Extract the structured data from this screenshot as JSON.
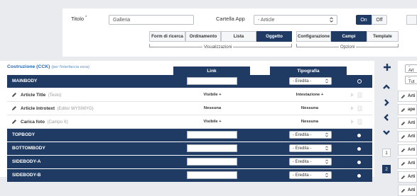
{
  "header": {
    "title_label": "Titolo",
    "title_required": "*",
    "title_value": "Galleria",
    "folder_label": "Cartella App",
    "folder_value": "- Article",
    "toggle_on": "On",
    "toggle_off": "Off"
  },
  "tabs_left": [
    "Form di ricerca",
    "Ordinamento",
    "Lista",
    "Oggetto"
  ],
  "tabs_left_group": "Visualizzazioni",
  "tabs_right": [
    "Configurazione",
    "Campi",
    "Template"
  ],
  "tabs_right_group": "Opzioni",
  "construction": {
    "title": "Costruzione (CCK)",
    "subtitle": "(per l'interfaccia voce)",
    "col_link": "Link",
    "col_typo": "Tipografia",
    "inherited": "- Eredita -"
  },
  "rows": [
    {
      "type": "position",
      "name": "MAINBODY"
    },
    {
      "type": "field",
      "name": "Article Title",
      "meta": "(Testo)",
      "link": "Visibile +",
      "typo": "Intestazione +"
    },
    {
      "type": "field",
      "name": "Article Introtext",
      "meta": "(Editor WYSIWYG)",
      "link": "Nessuna",
      "typo": "Nessuna"
    },
    {
      "type": "field",
      "name": "Carica foto",
      "meta": "(Campo X)",
      "link": "Visibile +",
      "typo": "Nessuna"
    },
    {
      "type": "position",
      "name": "TOPBODY"
    },
    {
      "type": "position",
      "name": "BOTTOMBODY"
    },
    {
      "type": "position",
      "name": "SIDEBODY-A"
    },
    {
      "type": "position",
      "name": "SIDEBODY-B"
    }
  ],
  "right_panel": {
    "select1": "- Art",
    "select2": "-Tut",
    "items": [
      "Arti",
      "ape",
      "Arti",
      "Arti",
      "Arti",
      "Arti",
      "Arti",
      "Arti"
    ],
    "pages": [
      "1",
      "2"
    ]
  },
  "colors": {
    "navy": "#1f3b63",
    "background": "#e9ebee"
  }
}
